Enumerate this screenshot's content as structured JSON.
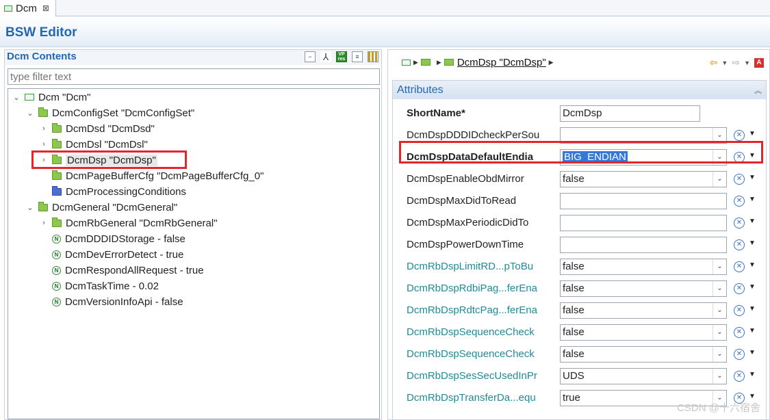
{
  "tab": {
    "label": "Dcm",
    "close": "⊠"
  },
  "editor": {
    "title": "BSW Editor"
  },
  "contents": {
    "title": "Dcm Contents",
    "filter_placeholder": "type filter text",
    "tools": [
      "collapse-all-icon",
      "link-icon",
      "vp-res-icon",
      "document-icon",
      "table-icon"
    ],
    "tree": [
      {
        "label": "Dcm \"Dcm\"",
        "icon": "module",
        "arrow": "⌄",
        "indent": 0
      },
      {
        "label": "DcmConfigSet \"DcmConfigSet\"",
        "icon": "folder",
        "arrow": "⌄",
        "indent": 1
      },
      {
        "label": "DcmDsd \"DcmDsd\"",
        "icon": "folder",
        "arrow": "›",
        "indent": 2
      },
      {
        "label": "DcmDsl \"DcmDsl\"",
        "icon": "folder",
        "arrow": "›",
        "indent": 2
      },
      {
        "label": "DcmDsp \"DcmDsp\"",
        "icon": "folder",
        "arrow": "›",
        "indent": 2,
        "selected": true
      },
      {
        "label": "DcmPageBufferCfg \"DcmPageBufferCfg_0\"",
        "icon": "folder",
        "arrow": "",
        "indent": 2
      },
      {
        "label": "DcmProcessingConditions",
        "icon": "folder-blue",
        "arrow": "",
        "indent": 2
      },
      {
        "label": "DcmGeneral \"DcmGeneral\"",
        "icon": "folder",
        "arrow": "⌄",
        "indent": 1
      },
      {
        "label": "DcmRbGeneral \"DcmRbGeneral\"",
        "icon": "folder",
        "arrow": "›",
        "indent": 2
      },
      {
        "label": "DcmDDDIDStorage - false",
        "icon": "param",
        "arrow": "",
        "indent": 2
      },
      {
        "label": "DcmDevErrorDetect - true",
        "icon": "param",
        "arrow": "",
        "indent": 2
      },
      {
        "label": "DcmRespondAllRequest - true",
        "icon": "param",
        "arrow": "",
        "indent": 2
      },
      {
        "label": "DcmTaskTime - 0.02",
        "icon": "param",
        "arrow": "",
        "indent": 2
      },
      {
        "label": "DcmVersionInfoApi - false",
        "icon": "param",
        "arrow": "",
        "indent": 2
      }
    ]
  },
  "breadcrumb": {
    "current": "DcmDsp \"DcmDsp\""
  },
  "attributes": {
    "title": "Attributes",
    "rows": [
      {
        "label": "ShortName*",
        "value": "DcmDsp",
        "style": "bold",
        "kind": "text-short"
      },
      {
        "label": "DcmDspDDDIDcheckPerSou",
        "value": "",
        "style": "normal",
        "kind": "combo"
      },
      {
        "label": "DcmDspDataDefaultEndia",
        "value": "BIG_ENDIAN",
        "style": "bold",
        "kind": "combo",
        "selected": true
      },
      {
        "label": "DcmDspEnableObdMirror",
        "value": "false",
        "style": "normal",
        "kind": "combo"
      },
      {
        "label": "DcmDspMaxDidToRead",
        "value": "",
        "style": "normal",
        "kind": "text"
      },
      {
        "label": "DcmDspMaxPeriodicDidTo",
        "value": "",
        "style": "normal",
        "kind": "text"
      },
      {
        "label": "DcmDspPowerDownTime",
        "value": "",
        "style": "normal",
        "kind": "text"
      },
      {
        "label": "DcmRbDspLimitRD...pToBu",
        "value": "false",
        "style": "teal",
        "kind": "combo"
      },
      {
        "label": "DcmRbDspRdbiPag...ferEna",
        "value": "false",
        "style": "teal",
        "kind": "combo"
      },
      {
        "label": "DcmRbDspRdtcPag...ferEna",
        "value": "false",
        "style": "teal",
        "kind": "combo"
      },
      {
        "label": "DcmRbDspSequenceCheck",
        "value": "false",
        "style": "teal",
        "kind": "combo"
      },
      {
        "label": "DcmRbDspSequenceCheck",
        "value": "false",
        "style": "teal",
        "kind": "combo"
      },
      {
        "label": "DcmRbDspSesSecUsedInPr",
        "value": "UDS",
        "style": "teal",
        "kind": "combo"
      },
      {
        "label": "DcmRbDspTransferDa...equ",
        "value": "true",
        "style": "teal",
        "kind": "combo"
      }
    ]
  },
  "watermark": "CSDN @十六宿舍",
  "colors": {
    "accent": "#2466b0",
    "highlight": "#e5242c",
    "teal": "#1f8a99",
    "selection": "#3477d6"
  }
}
